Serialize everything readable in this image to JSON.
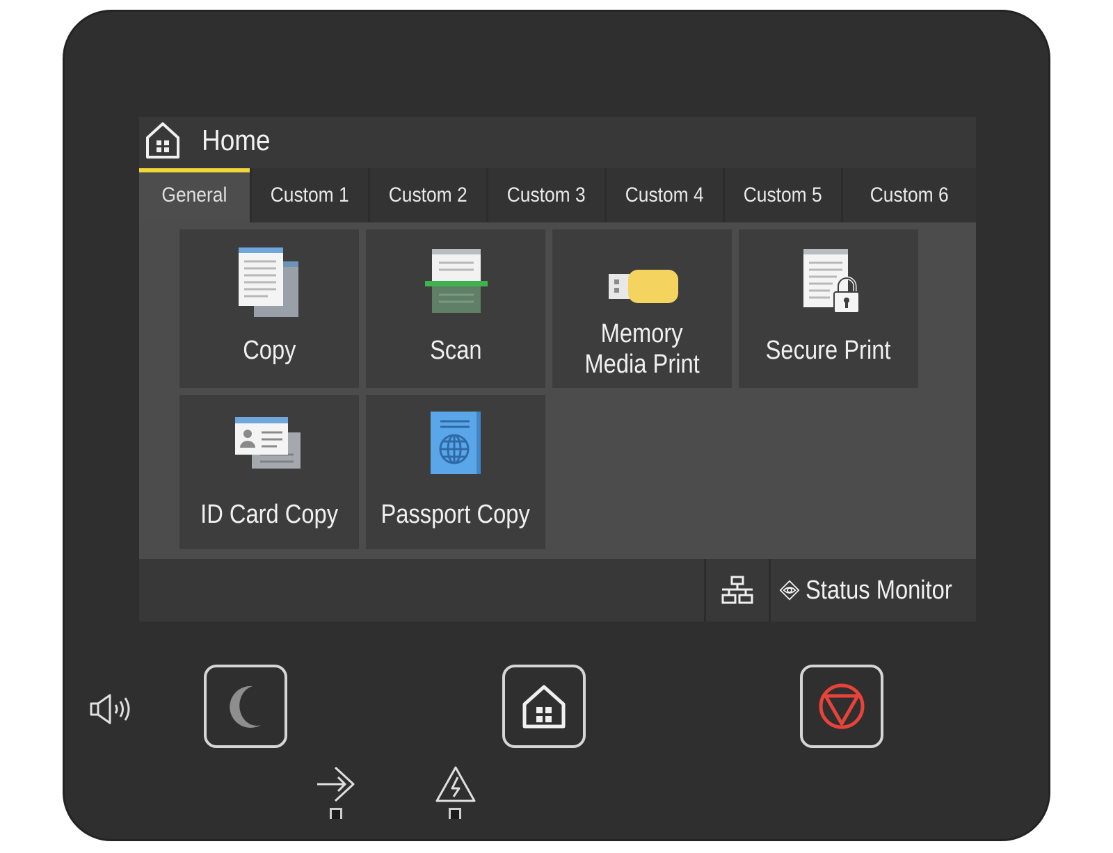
{
  "screen": {
    "title": "Home",
    "tabs": [
      {
        "label": "General",
        "active": true
      },
      {
        "label": "Custom 1",
        "active": false
      },
      {
        "label": "Custom 2",
        "active": false
      },
      {
        "label": "Custom 3",
        "active": false
      },
      {
        "label": "Custom 4",
        "active": false
      },
      {
        "label": "Custom 5",
        "active": false
      },
      {
        "label": "Custom 6",
        "active": false
      }
    ],
    "tiles": [
      {
        "line1": "Copy",
        "line2": "",
        "icon": "copy-icon"
      },
      {
        "line1": "Scan",
        "line2": "",
        "icon": "scan-icon"
      },
      {
        "line1": "Memory",
        "line2": "Media Print",
        "icon": "usb-memory-icon"
      },
      {
        "line1": "Secure Print",
        "line2": "",
        "icon": "secure-print-lock-icon"
      },
      {
        "line1": "ID Card Copy",
        "line2": "",
        "icon": "id-card-icon"
      },
      {
        "line1": "Passport Copy",
        "line2": "",
        "icon": "passport-icon"
      }
    ],
    "status_monitor_label": "Status Monitor"
  },
  "hardware": {
    "buttons": [
      "sleep-moon-icon",
      "home-icon",
      "stop-icon"
    ],
    "indicators": [
      "sound-volume-icon",
      "data-indicator-icon",
      "error-warning-icon"
    ]
  },
  "colors": {
    "active_tab_underline": "#f2d83a",
    "stop_button": "#e8433a",
    "usb_yellow": "#f4d35e",
    "passport_blue": "#5aa6e8",
    "scan_green": "#3fb24f"
  }
}
